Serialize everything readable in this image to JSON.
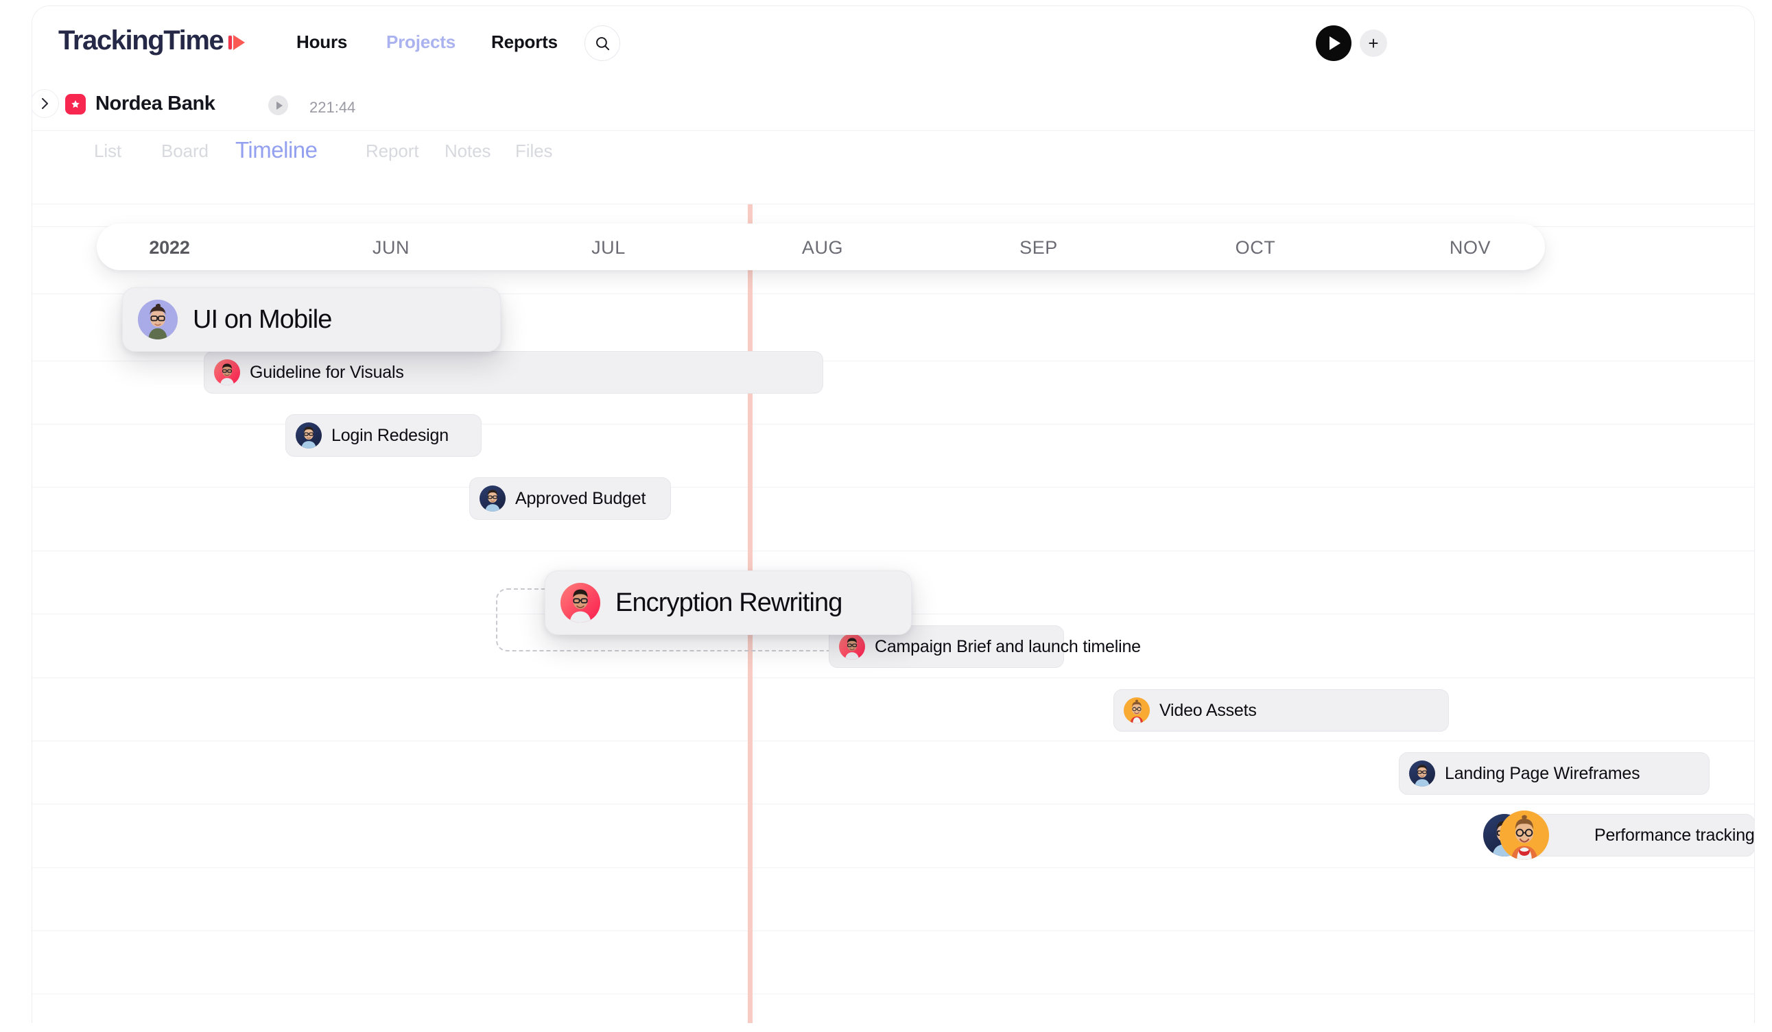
{
  "app": {
    "logo_text": "TrackingTime",
    "nav": [
      {
        "label": "Hours",
        "active": true
      },
      {
        "label": "Projects",
        "active": false
      },
      {
        "label": "Reports",
        "active": true
      }
    ],
    "search_icon": "search-icon",
    "play_icon": "play-icon",
    "add_icon": "plus-icon"
  },
  "breadcrumb": {
    "expand_icon": "chevron-right-icon",
    "project_badge_icon": "star-icon",
    "project_name": "Nordea Bank",
    "project_play_icon": "play-icon",
    "tracked_time": "221:44"
  },
  "tabs": [
    {
      "label": "List",
      "active": false
    },
    {
      "label": "Board",
      "active": false
    },
    {
      "label": "Timeline",
      "active": true
    },
    {
      "label": "Report",
      "active": false
    },
    {
      "label": "Notes",
      "active": false
    },
    {
      "label": "Files",
      "active": false
    }
  ],
  "timeline": {
    "year": "2022",
    "months": [
      "JUN",
      "JUL",
      "AUG",
      "SEP",
      "OCT",
      "NOV"
    ],
    "today_marker_color": "#f8ccc3",
    "accent_color": "#92a0ef",
    "badge_color": "#f8274f",
    "tasks": [
      {
        "name": "UI on Mobile",
        "assignees": [
          "woman-purple"
        ],
        "dragging": true
      },
      {
        "name": "Guideline for Visuals",
        "assignees": [
          "man-red"
        ],
        "dragging": false
      },
      {
        "name": "Login Redesign",
        "assignees": [
          "man-navy"
        ],
        "dragging": false
      },
      {
        "name": "Approved Budget",
        "assignees": [
          "man-navy"
        ],
        "dragging": false
      },
      {
        "name": "Encryption Rewriting",
        "assignees": [
          "man-red"
        ],
        "dragging": true
      },
      {
        "name": "Campaign Brief and launch timeline",
        "assignees": [
          "man-red"
        ],
        "dragging": false
      },
      {
        "name": "Video Assets",
        "assignees": [
          "woman-orange"
        ],
        "dragging": false
      },
      {
        "name": "Landing Page Wireframes",
        "assignees": [
          "man-navy"
        ],
        "dragging": false
      },
      {
        "name": "Performance tracking",
        "assignees": [
          "man-navy",
          "woman-orange"
        ],
        "dragging": false
      }
    ]
  }
}
